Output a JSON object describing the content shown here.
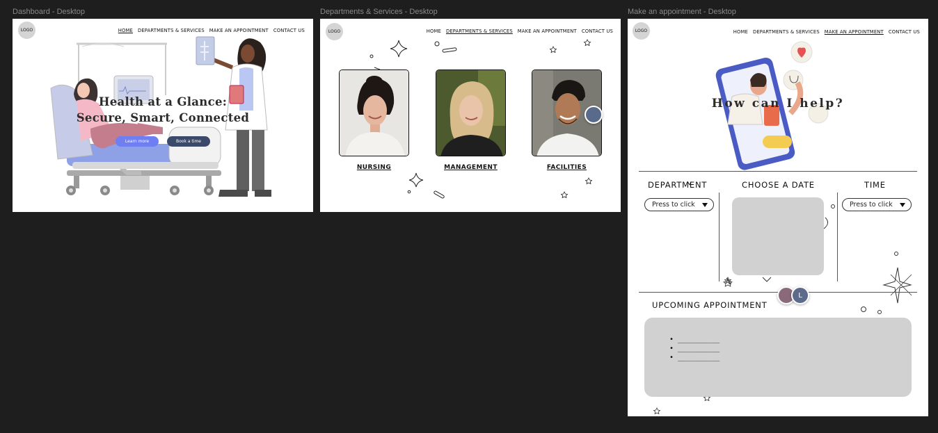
{
  "frames": {
    "dashboard": {
      "label": "Dashboard - Desktop",
      "logo": "LOGO",
      "nav": [
        "HOME",
        "DEPARTMENTS & SERVICES",
        "MAKE AN APPOINTMENT",
        "CONTACT US"
      ],
      "active_nav": "HOME",
      "hero_title_line1": "Health at a Glance:",
      "hero_title_line2": "Secure, Smart, Connected",
      "learn_more": "Learn more",
      "book_time": "Book a time"
    },
    "departments": {
      "label": "Departments & Services - Desktop",
      "logo": "LOGO",
      "nav": [
        "HOME",
        "DEPARTMENTS & SERVICES",
        "MAKE AN APPOINTMENT",
        "CONTACT US"
      ],
      "active_nav": "DEPARTMENTS & SERVICES",
      "cards": [
        "NURSING",
        "MANAGEMENT",
        "FACILITIES"
      ]
    },
    "appointment": {
      "label": "Make an appointment - Desktop",
      "logo": "LOGO",
      "nav": [
        "HOME",
        "DEPARTMENTS & SERVICES",
        "MAKE AN APPOINTMENT",
        "CONTACT US"
      ],
      "active_nav": "MAKE AN APPOINTMENT",
      "help_title": "How can I help?",
      "department_heading": "DEPARTMENT",
      "date_heading": "CHOOSE A DATE",
      "time_heading": "TIME",
      "department_dropdown": "Press to click",
      "time_dropdown": "Press to click",
      "upcoming_heading": "UPCOMING APPOINTMENT",
      "upcoming_items": [
        "__________",
        "__________",
        "__________"
      ],
      "avatar_initial": "L"
    }
  },
  "colors": {
    "background": "#1e1e1e",
    "frame": "#ffffff",
    "primary_button": "#6f7ef0",
    "secondary_button": "#3b4a6b",
    "placeholder_gray": "#d1d1d1"
  }
}
